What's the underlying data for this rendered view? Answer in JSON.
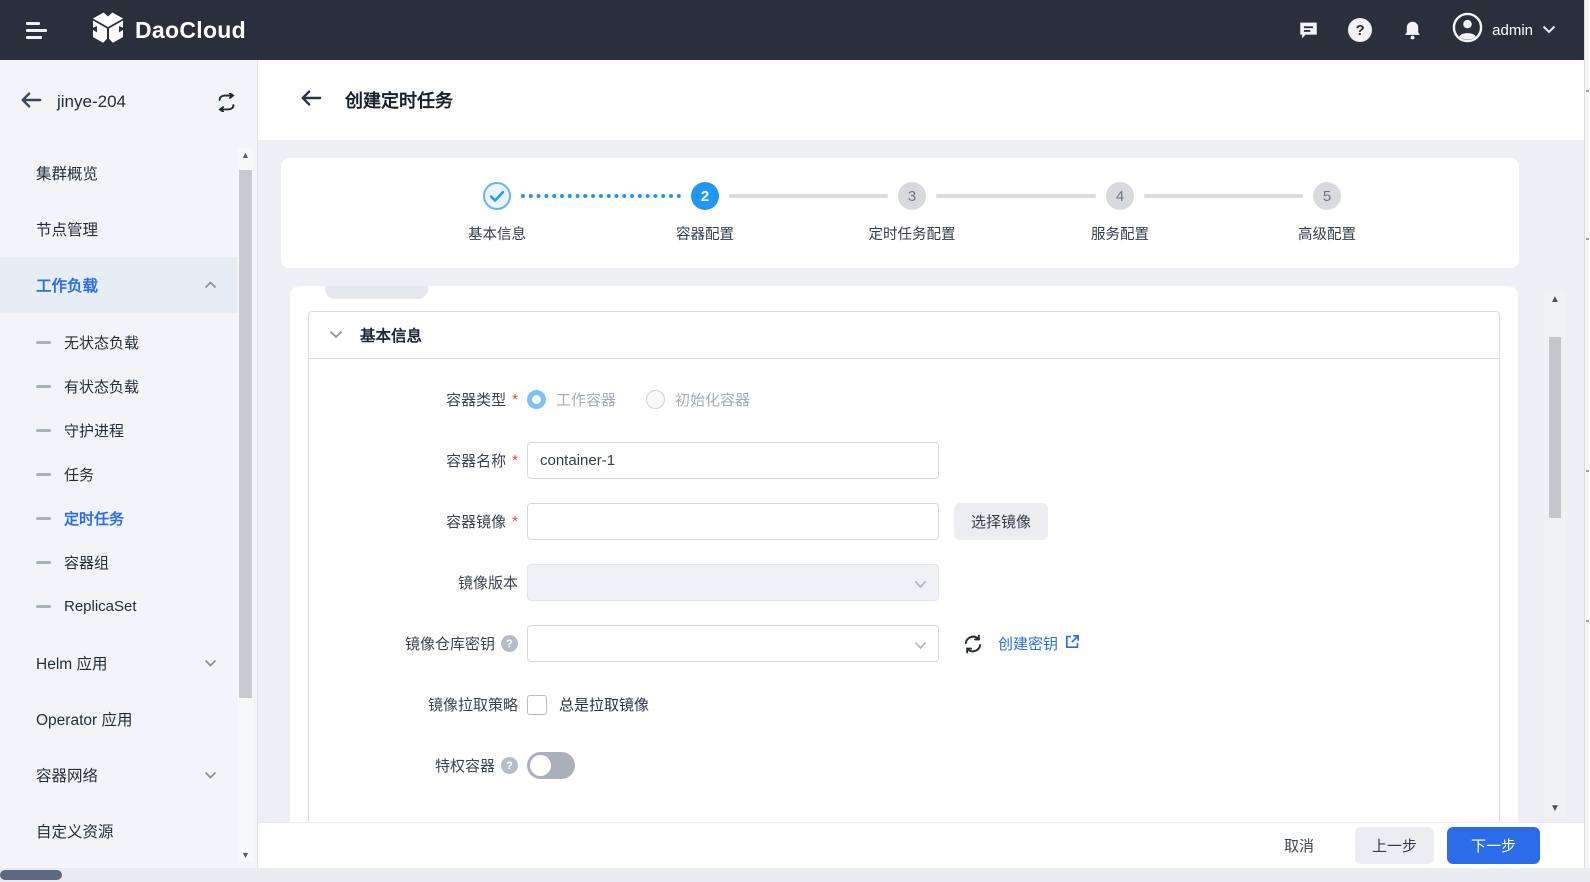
{
  "topbar": {
    "brand": "DaoCloud",
    "user": "admin",
    "icons": [
      "message-icon",
      "help-icon",
      "bell-icon",
      "avatar",
      "chevron-down-icon"
    ]
  },
  "sidebar": {
    "cluster_name": "jinye-204",
    "items": [
      {
        "label": "集群概览",
        "level": 1,
        "active": false
      },
      {
        "label": "节点管理",
        "level": 1,
        "active": false
      },
      {
        "label": "工作负载",
        "level": 1,
        "active": true,
        "chevron": "up"
      },
      {
        "label": "无状态负载",
        "level": 2,
        "active": false
      },
      {
        "label": "有状态负载",
        "level": 2,
        "active": false
      },
      {
        "label": "守护进程",
        "level": 2,
        "active": false
      },
      {
        "label": "任务",
        "level": 2,
        "active": false
      },
      {
        "label": "定时任务",
        "level": 2,
        "active": true
      },
      {
        "label": "容器组",
        "level": 2,
        "active": false
      },
      {
        "label": "ReplicaSet",
        "level": 2,
        "active": false
      },
      {
        "label": "Helm 应用",
        "level": 1,
        "active": false,
        "chevron": "down"
      },
      {
        "label": "Operator 应用",
        "level": 1,
        "active": false
      },
      {
        "label": "容器网络",
        "level": 1,
        "active": false,
        "chevron": "down"
      },
      {
        "label": "自定义资源",
        "level": 1,
        "active": false
      }
    ]
  },
  "page": {
    "title": "创建定时任务"
  },
  "stepper": {
    "steps": [
      {
        "num": "",
        "label": "基本信息",
        "state": "done"
      },
      {
        "num": "2",
        "label": "容器配置",
        "state": "current"
      },
      {
        "num": "3",
        "label": "定时任务配置",
        "state": "pending"
      },
      {
        "num": "4",
        "label": "服务配置",
        "state": "pending"
      },
      {
        "num": "5",
        "label": "高级配置",
        "state": "pending"
      }
    ]
  },
  "form": {
    "section_title": "基本信息",
    "container_type": {
      "label": "容器类型",
      "required": true,
      "options": [
        "工作容器",
        "初始化容器"
      ],
      "selected": "工作容器",
      "disabled": true
    },
    "container_name": {
      "label": "容器名称",
      "required": true,
      "value": "container-1"
    },
    "container_image": {
      "label": "容器镜像",
      "required": true,
      "value": "",
      "button": "选择镜像"
    },
    "image_version": {
      "label": "镜像版本",
      "value": "",
      "disabled": true
    },
    "registry_secret": {
      "label": "镜像仓库密钥",
      "value": "",
      "link": "创建密钥"
    },
    "pull_policy": {
      "label": "镜像拉取策略",
      "checkbox_label": "总是拉取镜像",
      "checked": false
    },
    "privileged": {
      "label": "特权容器",
      "enabled": false
    }
  },
  "footer": {
    "cancel": "取消",
    "prev": "上一步",
    "next": "下一步"
  },
  "colors": {
    "topbar_bg": "#2a303b",
    "sidebar_bg": "#f2f4f7",
    "active_blue": "#2a6ee9",
    "step_blue": "#2196f3",
    "primary_button": "#2b6de9",
    "required_red": "#f03e3e",
    "page_bg": "#edeff3"
  }
}
